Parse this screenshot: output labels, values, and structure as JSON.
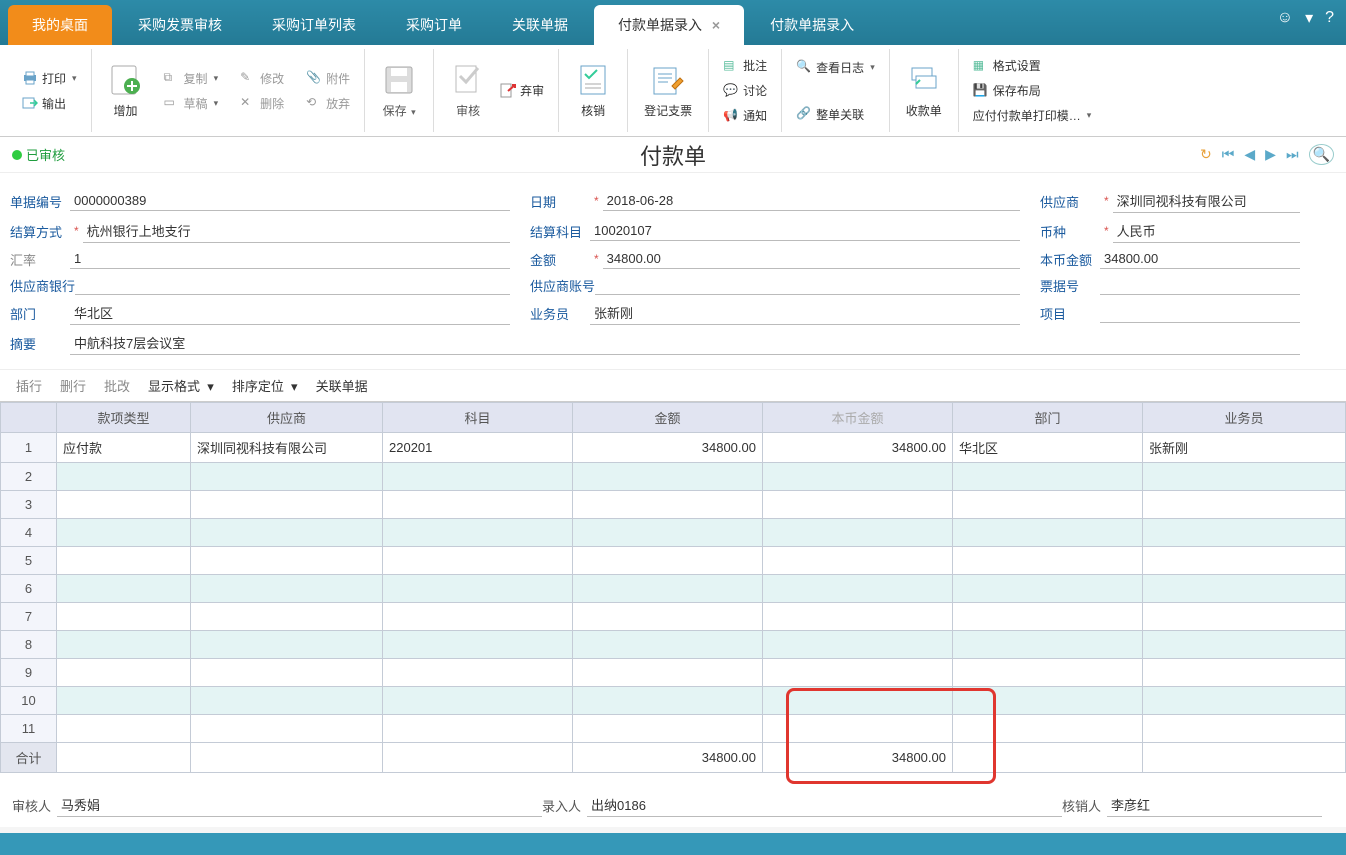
{
  "tabs": {
    "my_desktop": "我的桌面",
    "purchase_invoice_audit": "采购发票审核",
    "purchase_order_list": "采购订单列表",
    "purchase_order": "采购订单",
    "related_docs": "关联单据",
    "payment_entry_active": "付款单据录入",
    "close_x": "×",
    "payment_entry_2": "付款单据录入"
  },
  "toolbar": {
    "print": "打印",
    "output": "输出",
    "add": "增加",
    "copy": "复制",
    "draft": "草稿",
    "modify": "修改",
    "delete": "删除",
    "attachment": "附件",
    "discard": "放弃",
    "save": "保存",
    "audit": "审核",
    "deprecate": "弃审",
    "writeoff": "核销",
    "register_cheque": "登记支票",
    "remark": "批注",
    "discuss": "讨论",
    "notify": "通知",
    "view_log": "查看日志",
    "whole_related": "整单关联",
    "receipt": "收款单",
    "format_setting": "格式设置",
    "save_layout": "保存布局",
    "print_template": "应付付款单打印模…"
  },
  "status": {
    "label": "已审核"
  },
  "page_title": "付款单",
  "form": {
    "doc_no_label": "单据编号",
    "doc_no": "0000000389",
    "method_label": "结算方式",
    "method": "杭州银行上地支行",
    "rate_label": "汇率",
    "rate": "1",
    "supplier_bank_label": "供应商银行",
    "supplier_bank": "",
    "dept_label": "部门",
    "dept": "华北区",
    "summary_label": "摘要",
    "summary": "中航科技7层会议室",
    "date_label": "日期",
    "date": "2018-06-28",
    "subject_label": "结算科目",
    "subject": "10020107",
    "amount_label": "金额",
    "amount": "34800.00",
    "supplier_acct_label": "供应商账号",
    "supplier_acct": "",
    "clerk_label": "业务员",
    "clerk": "张新刚",
    "supplier_label": "供应商",
    "supplier": "深圳同视科技有限公司",
    "currency_label": "币种",
    "currency": "人民币",
    "base_amount_label": "本币金额",
    "base_amount": "34800.00",
    "bill_no_label": "票据号",
    "bill_no": "",
    "project_label": "项目",
    "project": ""
  },
  "grid_toolbar": {
    "insert": "插行",
    "delete": "删行",
    "batch": "批改",
    "display_format": "显示格式",
    "sort": "排序定位",
    "related": "关联单据"
  },
  "grid": {
    "headers": {
      "type": "款项类型",
      "supplier": "供应商",
      "subject": "科目",
      "amount": "金额",
      "base_amount": "本币金额",
      "dept": "部门",
      "clerk": "业务员"
    },
    "row1": {
      "num": "1",
      "type": "应付款",
      "supplier": "深圳同视科技有限公司",
      "subject": "220201",
      "amount": "34800.00",
      "base_amount": "34800.00",
      "dept": "华北区",
      "clerk": "张新刚"
    },
    "rownums": [
      "2",
      "3",
      "4",
      "5",
      "6",
      "7",
      "8",
      "9",
      "10",
      "11"
    ],
    "total_label": "合计",
    "total_amount": "34800.00",
    "total_base_amount": "34800.00"
  },
  "signatures": {
    "auditor_label": "审核人",
    "auditor": "马秀娟",
    "entry_label": "录入人",
    "entry": "出纳0186",
    "writeoff_label": "核销人",
    "writeoff": "李彦红"
  }
}
